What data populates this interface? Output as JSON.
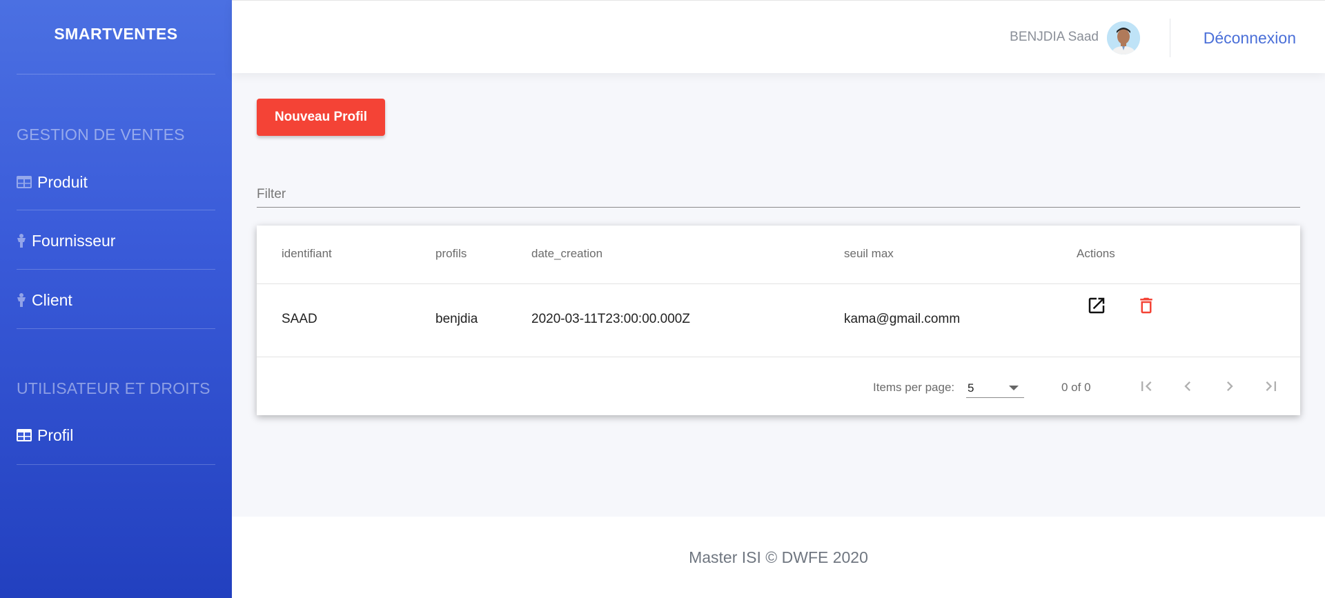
{
  "sidebar": {
    "brand": "SMARTVENTES",
    "sections": [
      {
        "title": "GESTION DE VENTES",
        "items": [
          {
            "label": "Produit",
            "icon": "table-icon"
          },
          {
            "label": "Fournisseur",
            "icon": "person-icon"
          },
          {
            "label": "Client",
            "icon": "person-icon"
          }
        ]
      },
      {
        "title": "UTILISATEUR ET DROITS",
        "items": [
          {
            "label": "Profil",
            "icon": "table-icon"
          }
        ]
      }
    ]
  },
  "header": {
    "user_name": "BENJDIA Saad",
    "logout_label": "Déconnexion"
  },
  "main": {
    "new_button_label": "Nouveau Profil",
    "filter_placeholder": "Filter",
    "table": {
      "columns": [
        "identifiant",
        "profils",
        "date_creation",
        "seuil max",
        "Actions"
      ],
      "rows": [
        {
          "identifiant": "SAAD",
          "profils": "benjdia",
          "date_creation": "2020-03-11T23:00:00.000Z",
          "seuil_max": "kama@gmail.comm"
        }
      ],
      "actions": [
        "open-in-new-icon",
        "delete-icon"
      ]
    },
    "paginator": {
      "items_per_page_label": "Items per page:",
      "page_size": "5",
      "range_label": "0 of 0"
    }
  },
  "footer": {
    "text": "Master ISI © DWFE 2020"
  },
  "colors": {
    "sidebar_top": "#4b70e2",
    "sidebar_bottom": "#2240bf",
    "accent_button": "#f44336",
    "link": "#4a6fd8",
    "delete_icon": "#f44336"
  }
}
